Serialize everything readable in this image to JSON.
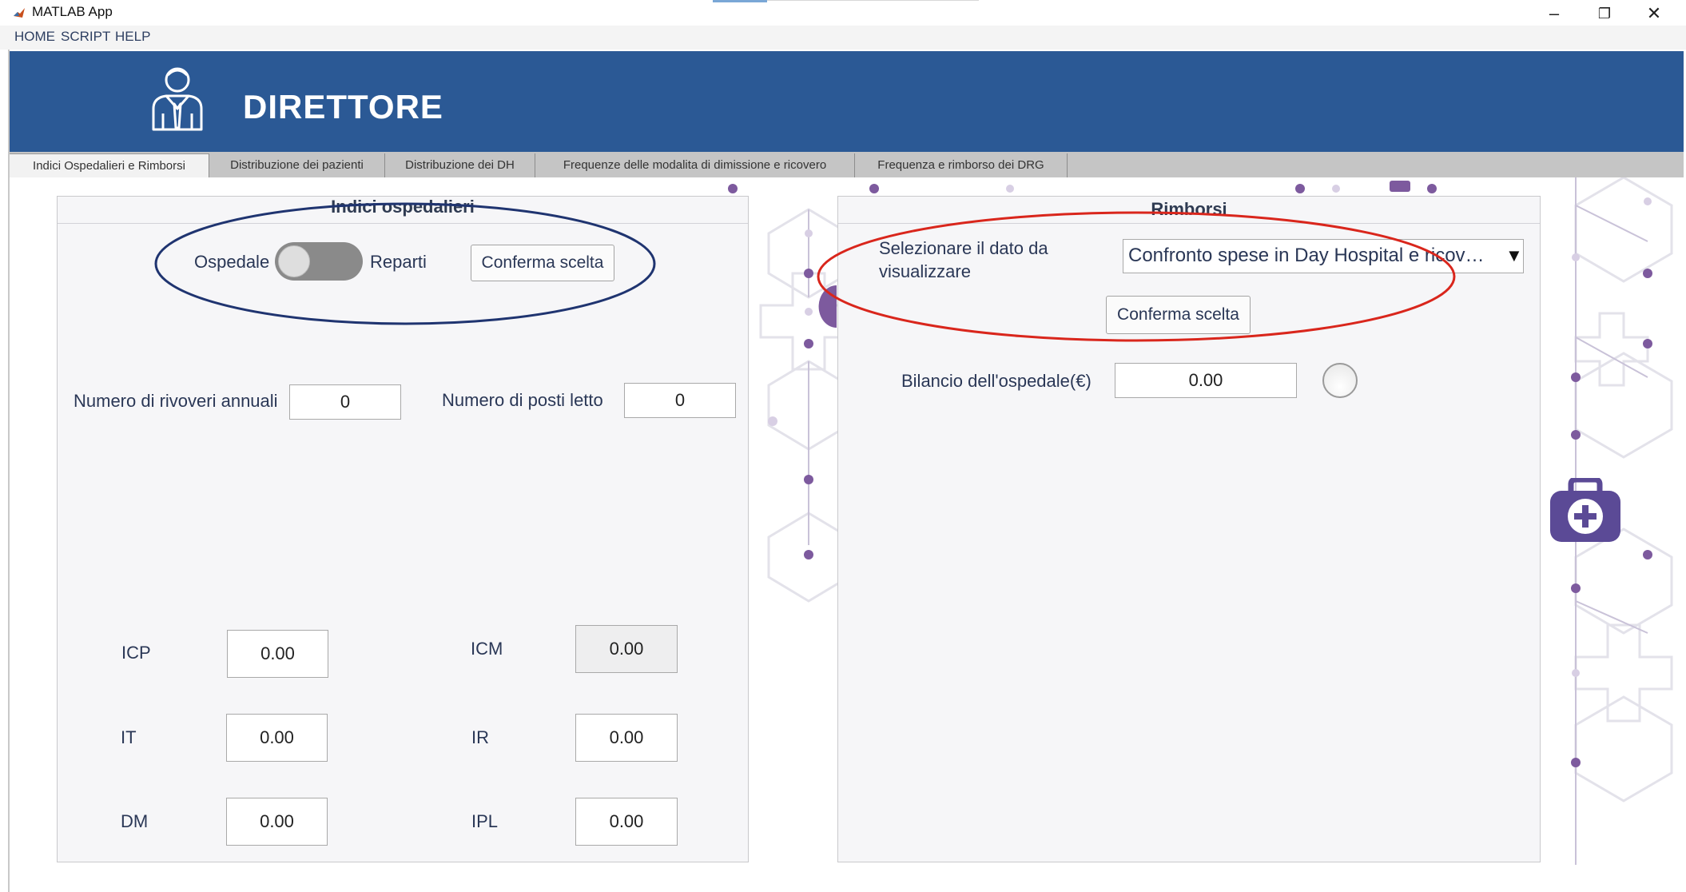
{
  "window": {
    "title": "MATLAB App",
    "minimize_icon": "minimize-icon",
    "maximize_icon": "restore-icon",
    "close_icon": "close-icon"
  },
  "menu": {
    "items": [
      "HOME",
      "SCRIPT",
      "HELP"
    ]
  },
  "header": {
    "title": "DIRETTORE",
    "icon": "user-tie-icon",
    "color": "#2b5995"
  },
  "tabs": [
    {
      "label": "Indici Ospedalieri e Rimborsi",
      "active": true
    },
    {
      "label": "Distribuzione dei pazienti",
      "active": false
    },
    {
      "label": "Distribuzione dei DH",
      "active": false
    },
    {
      "label": "Frequenze delle modalita di dimissione e ricovero",
      "active": false
    },
    {
      "label": "Frequenza e rimborso dei DRG",
      "active": false
    }
  ],
  "left_panel": {
    "title": "Indici ospedalieri",
    "switch": {
      "left_label": "Ospedale",
      "right_label": "Reparti",
      "state": "Ospedale"
    },
    "confirm_button": "Conferma scelta",
    "ricoveri_label": "Numero di rivoveri annuali",
    "ricoveri_value": "0",
    "posti_label": "Numero di posti letto",
    "posti_value": "0",
    "indices": {
      "ICP": {
        "label": "ICP",
        "value": "0.00"
      },
      "ICM": {
        "label": "ICM",
        "value": "0.00"
      },
      "IT": {
        "label": "IT",
        "value": "0.00"
      },
      "IR": {
        "label": "IR",
        "value": "0.00"
      },
      "DM": {
        "label": "DM",
        "value": "0.00"
      },
      "IPL": {
        "label": "IPL",
        "value": "0.00"
      }
    }
  },
  "right_panel": {
    "title": "Rimborsi",
    "select_label": "Selezionare il dato da visualizzare",
    "select_label_line1": "Selezionare il dato da",
    "select_label_line2": "visualizzare",
    "dropdown_value": "Confronto spese in Day Hospital e ricov…",
    "dropdown_arrow": "▼",
    "confirm_button": "Conferma scelta",
    "balance_label": "Bilancio dell'ospedale(€)",
    "balance_value": "0.00",
    "lamp_state": "off"
  },
  "annotations": {
    "left_ellipse_color": "#1f3470",
    "right_ellipse_color": "#d9261c"
  },
  "background": {
    "pattern": "hexagon-network",
    "accent_color": "#7d5a9e",
    "medkit_icon": "medkit-icon"
  }
}
